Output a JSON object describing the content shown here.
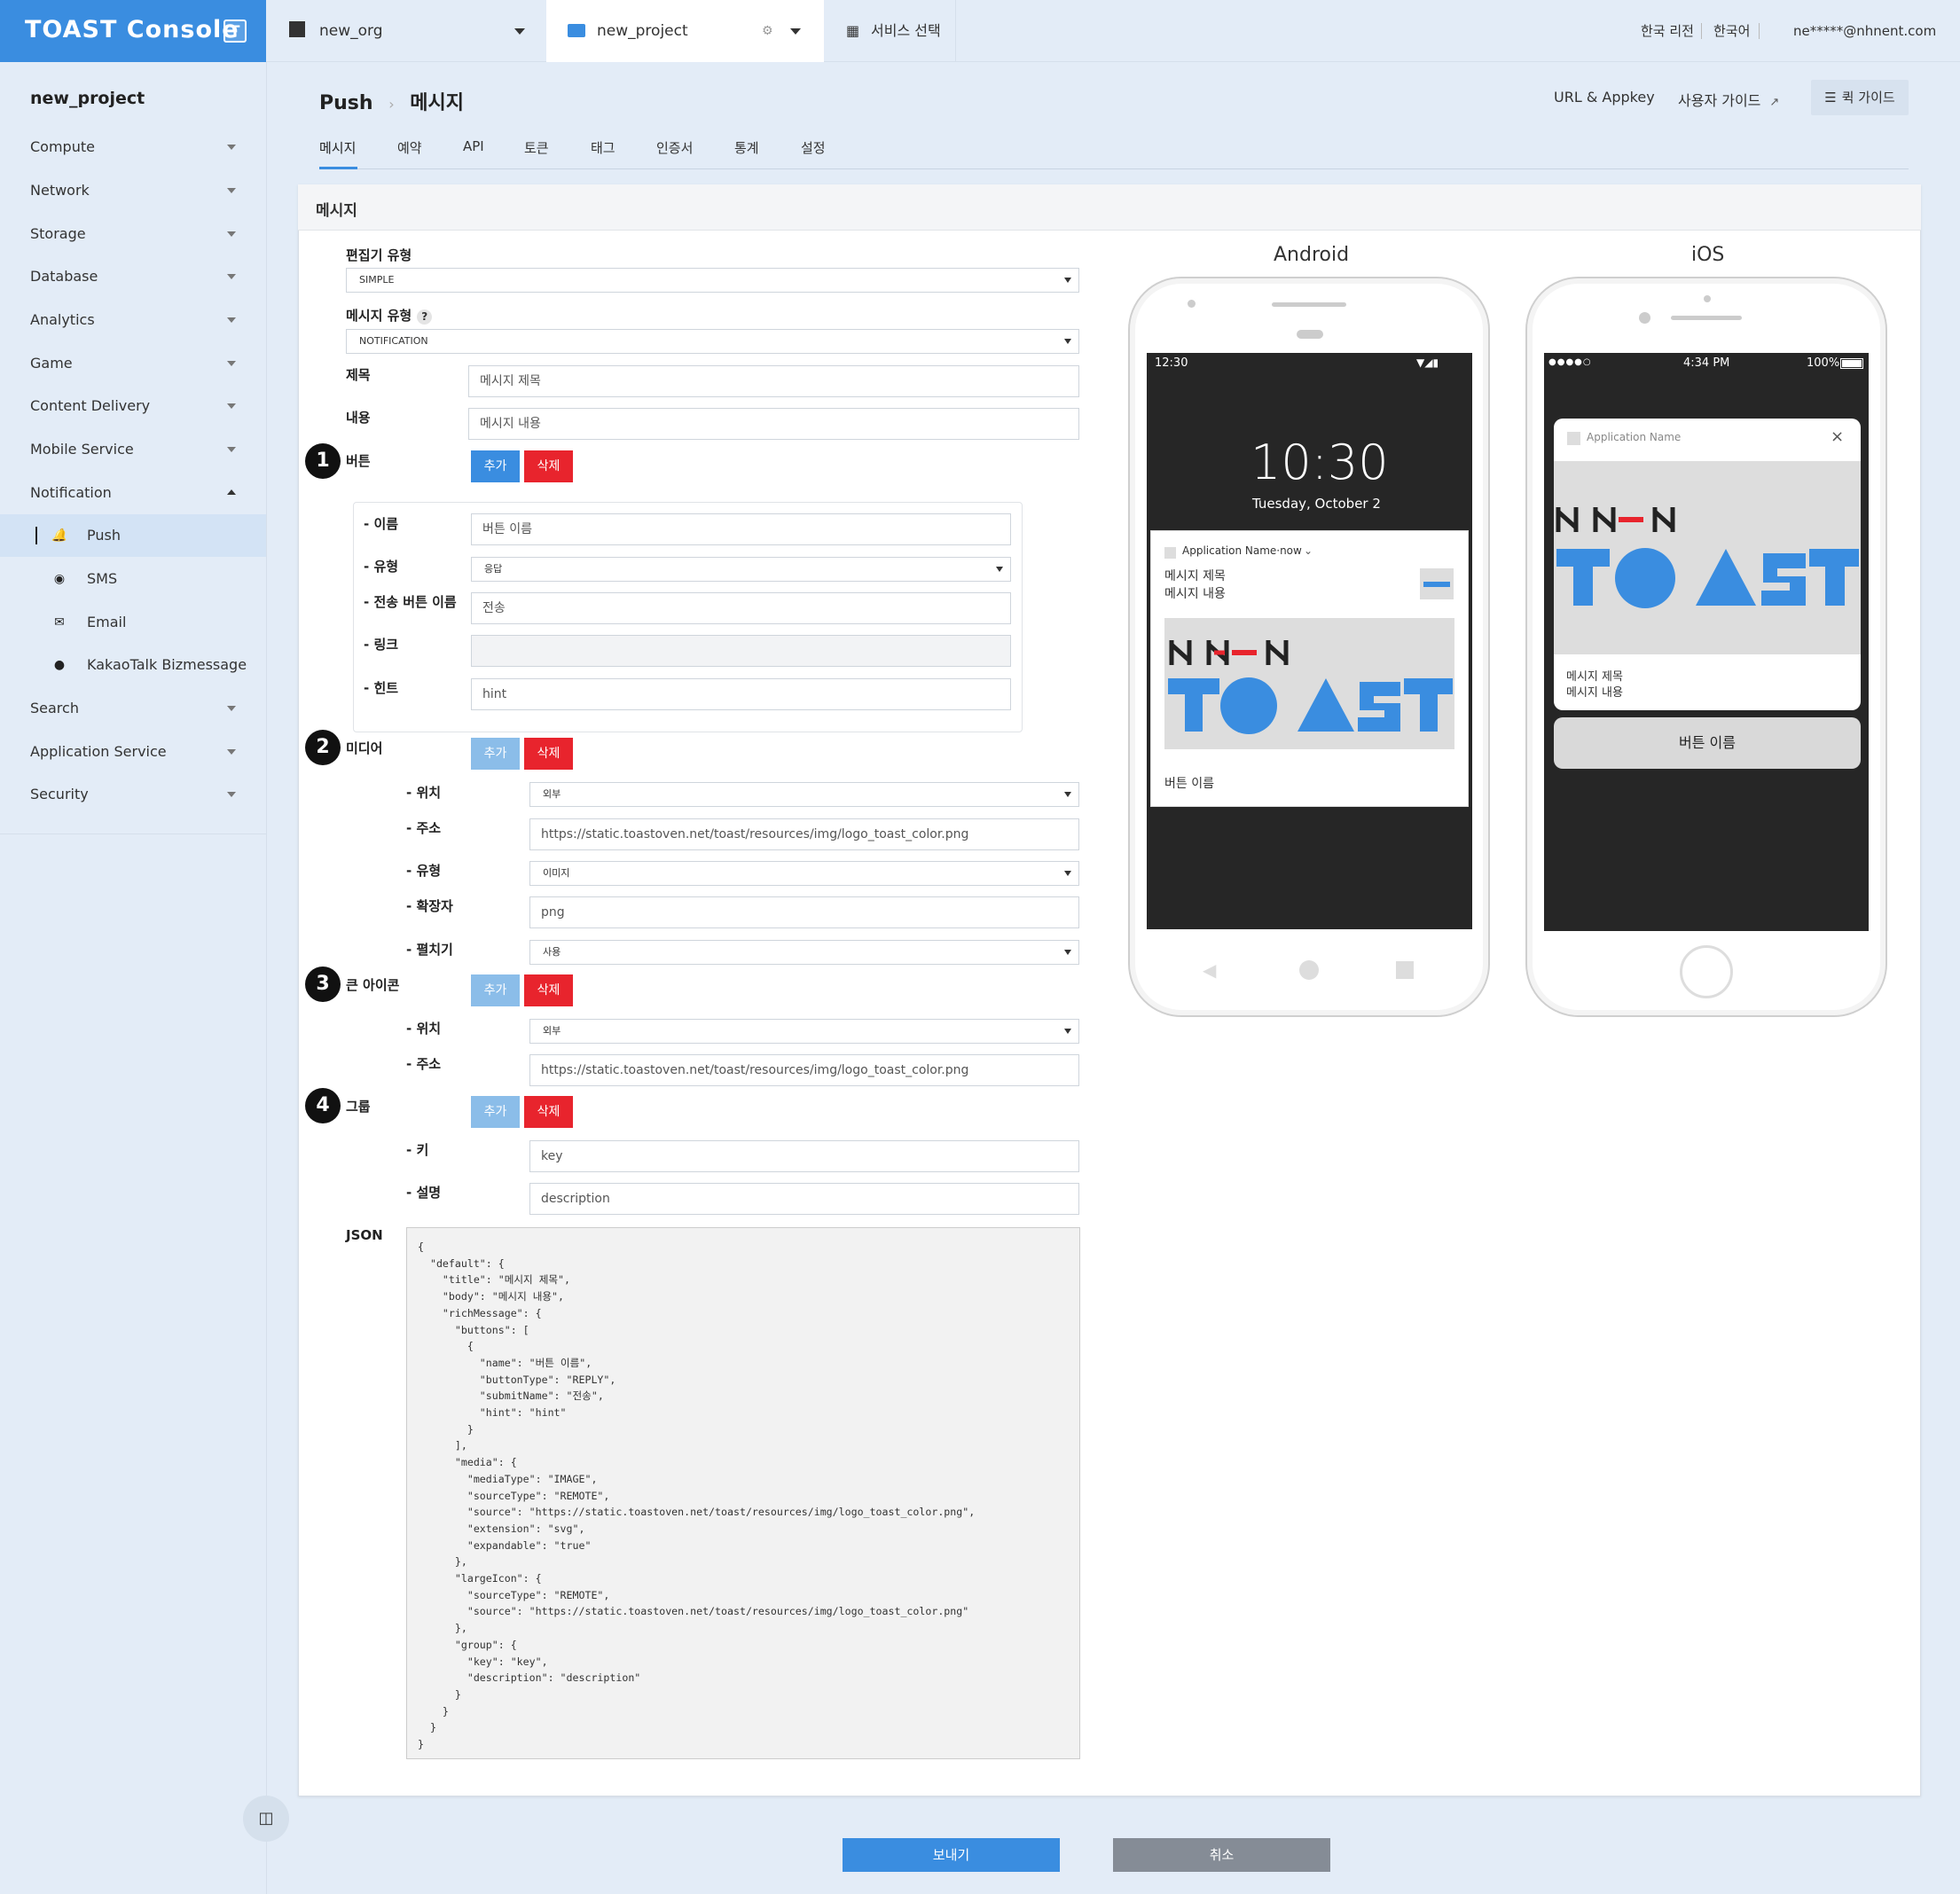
{
  "topbar": {
    "logo_text": "TOAST Console",
    "org": "new_org",
    "project": "new_project",
    "service_select": "서비스 선택",
    "region": "한국 리전",
    "language": "한국어",
    "user": "ne*****@nhnent.com"
  },
  "sidebar": {
    "project_name": "new_project",
    "items": [
      {
        "label": "Compute"
      },
      {
        "label": "Network"
      },
      {
        "label": "Storage"
      },
      {
        "label": "Database"
      },
      {
        "label": "Analytics"
      },
      {
        "label": "Game"
      },
      {
        "label": "Content Delivery"
      },
      {
        "label": "Mobile Service"
      },
      {
        "label": "Notification"
      },
      {
        "label": "Search"
      },
      {
        "label": "Application Service"
      },
      {
        "label": "Security"
      }
    ],
    "notification_sub": [
      {
        "label": "Push"
      },
      {
        "label": "SMS"
      },
      {
        "label": "Email"
      },
      {
        "label": "KakaoTalk Bizmessage"
      }
    ]
  },
  "page": {
    "breadcrumb_service": "Push",
    "breadcrumb_page": "메시지",
    "url_appkey": "URL & Appkey",
    "user_guide": "사용자 가이드",
    "quick_guide": "퀵 가이드",
    "tabs": [
      "메시지",
      "예약",
      "API",
      "토큰",
      "태그",
      "인증서",
      "통계",
      "설정"
    ],
    "panel_title": "메시지"
  },
  "form": {
    "editor_type_label": "편집기 유형",
    "editor_type_value": "SIMPLE",
    "message_type_label": "메시지 유형",
    "message_type_value": "NOTIFICATION",
    "title_label": "제목",
    "title_value": "메시지 제목",
    "body_label": "내용",
    "body_value": "메시지 내용",
    "add": "추가",
    "delete": "삭제",
    "button_section": "버튼",
    "btn_name_label": "- 이름",
    "btn_name_value": "버튼 이름",
    "btn_type_label": "- 유형",
    "btn_type_value": "응답",
    "btn_submit_label": "- 전송 버튼 이름",
    "btn_submit_value": "전송",
    "btn_link_label": "- 링크",
    "btn_link_value": "",
    "btn_hint_label": "- 힌트",
    "btn_hint_value": "hint",
    "media_section": "미디어",
    "media_location_label": "- 위치",
    "media_location_value": "외부",
    "media_address_label": "- 주소",
    "media_address_value": "https://static.toastoven.net/toast/resources/img/logo_toast_color.png",
    "media_type_label": "- 유형",
    "media_type_value": "이미지",
    "media_ext_label": "- 확장자",
    "media_ext_value": "png",
    "media_expand_label": "- 펼치기",
    "media_expand_value": "사용",
    "icon_section": "큰 아이콘",
    "icon_location_label": "- 위치",
    "icon_location_value": "외부",
    "icon_address_label": "- 주소",
    "icon_address_value": "https://static.toastoven.net/toast/resources/img/logo_toast_color.png",
    "group_section": "그룹",
    "group_key_label": "- 키",
    "group_key_value": "key",
    "group_desc_label": "- 설명",
    "group_desc_value": "description",
    "json_label": "JSON",
    "json_text": "{\n  \"default\": {\n    \"title\": \"메시지 제목\",\n    \"body\": \"메시지 내용\",\n    \"richMessage\": {\n      \"buttons\": [\n        {\n          \"name\": \"버튼 이름\",\n          \"buttonType\": \"REPLY\",\n          \"submitName\": \"전송\",\n          \"hint\": \"hint\"\n        }\n      ],\n      \"media\": {\n        \"mediaType\": \"IMAGE\",\n        \"sourceType\": \"REMOTE\",\n        \"source\": \"https://static.toastoven.net/toast/resources/img/logo_toast_color.png\",\n        \"extension\": \"svg\",\n        \"expandable\": \"true\"\n      },\n      \"largeIcon\": {\n        \"sourceType\": \"REMOTE\",\n        \"source\": \"https://static.toastoven.net/toast/resources/img/logo_toast_color.png\"\n      },\n      \"group\": {\n        \"key\": \"key\",\n        \"description\": \"description\"\n      }\n    }\n  }\n}"
  },
  "preview": {
    "android_title": "Android",
    "ios_title": "iOS",
    "android": {
      "status_time": "12:30",
      "clock": "10:30",
      "date": "Tuesday, October 2",
      "app_line": "Application Name·now",
      "title": "메시지 제목",
      "body": "메시지 내용",
      "button": "버튼 이름"
    },
    "ios": {
      "signal": "●●●●○",
      "time": "4:34 PM",
      "battery": "100%",
      "app": "Application Name",
      "title": "메시지 제목",
      "body": "메시지 내용",
      "button": "버튼 이름"
    }
  },
  "actions": {
    "send": "보내기",
    "cancel": "취소"
  }
}
